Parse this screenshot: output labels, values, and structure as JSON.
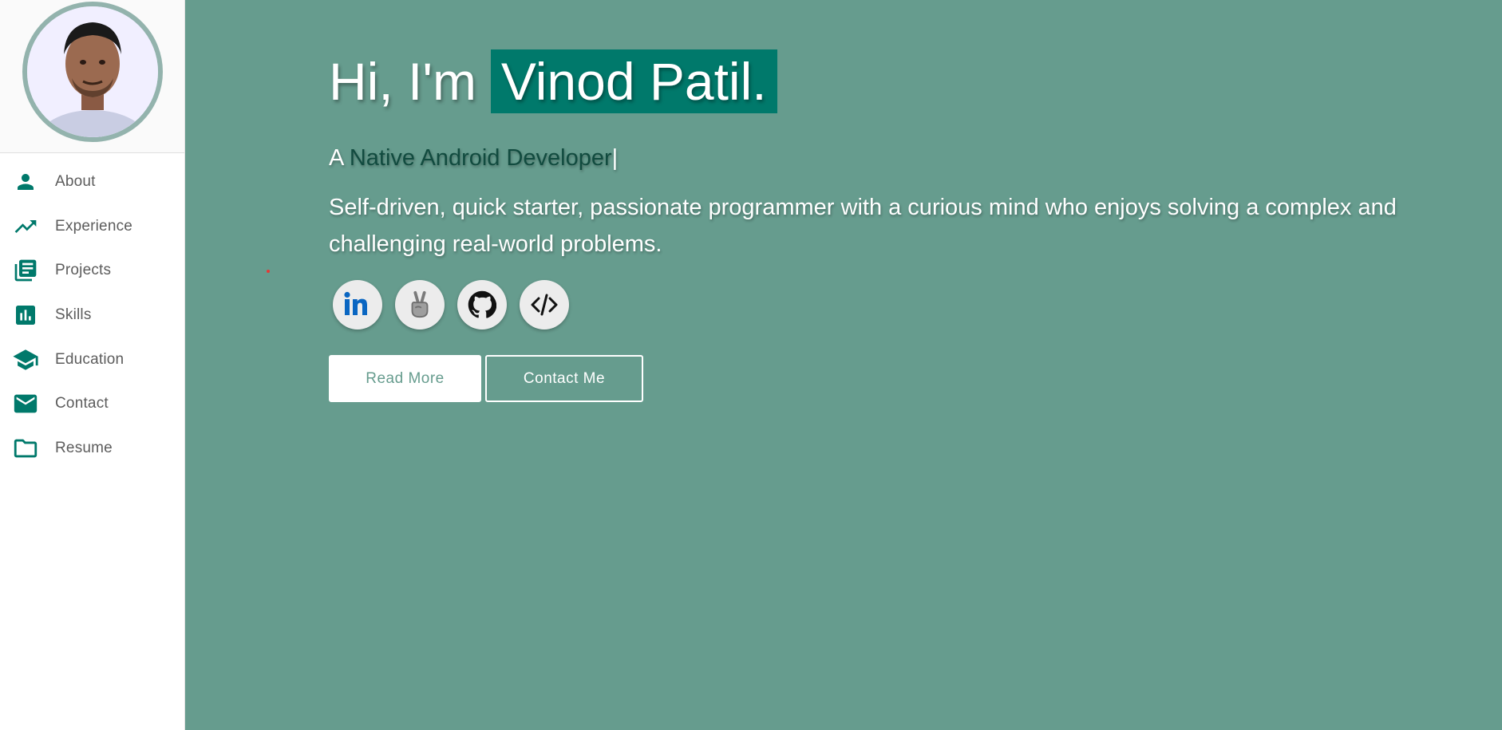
{
  "sidebar": {
    "avatar_alt": "Vinod Patil profile photo",
    "items": [
      {
        "label": "About",
        "icon": "person-icon"
      },
      {
        "label": "Experience",
        "icon": "trending-up-icon"
      },
      {
        "label": "Projects",
        "icon": "article-icon"
      },
      {
        "label": "Skills",
        "icon": "bar-chart-icon"
      },
      {
        "label": "Education",
        "icon": "school-icon"
      },
      {
        "label": "Contact",
        "icon": "mail-icon"
      },
      {
        "label": "Resume",
        "icon": "folder-icon"
      }
    ]
  },
  "hero": {
    "greeting": "Hi, I'm",
    "name": "Vinod Patil.",
    "subtitle_prefix": "A",
    "role": "Native Android Developer",
    "cursor": "|",
    "description": "Self-driven, quick starter, passionate programmer with a curious mind who enjoys solving a complex and challenging real-world problems."
  },
  "socials": [
    {
      "name": "linkedin-icon"
    },
    {
      "name": "angellist-icon"
    },
    {
      "name": "github-icon"
    },
    {
      "name": "code-icon"
    }
  ],
  "buttons": {
    "read_more": "Read More",
    "contact_me": "Contact Me"
  },
  "colors": {
    "accent": "#00796b",
    "background": "#669c8e",
    "role_text": "#114b3f",
    "sidebar_icon": "#00796b"
  }
}
